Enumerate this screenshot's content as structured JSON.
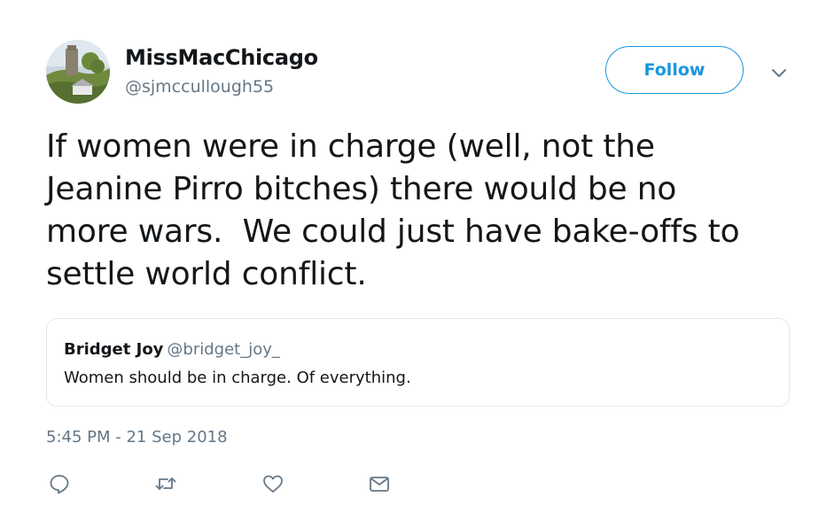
{
  "author": {
    "display_name": "MissMacChicago",
    "handle": "@sjmccullough55"
  },
  "follow_label": "Follow",
  "tweet_text": "If women were in charge (well, not the\nJeanine Pirro bitches) there would be no\nmore wars.  We could just have bake-offs to\nsettle world conflict.",
  "quoted_tweet": {
    "name": "Bridget Joy",
    "handle": "@bridget_joy_",
    "text": "Women should be in charge. Of everything."
  },
  "timestamp": "5:45 PM - 21 Sep 2018",
  "actions": [
    "reply-icon",
    "retweet-icon",
    "like-icon",
    "message-icon"
  ],
  "colors": {
    "accent": "#1b95e0",
    "secondary_text": "#657786",
    "border": "#e1e8ed"
  }
}
